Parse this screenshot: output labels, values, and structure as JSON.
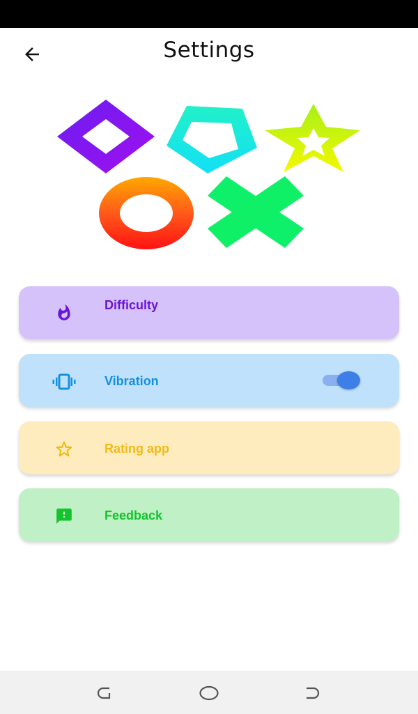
{
  "header": {
    "title": "Settings",
    "back_icon": "arrow-left-icon"
  },
  "logo": {
    "shapes": [
      "diamond",
      "pentagon",
      "star",
      "ring",
      "cross"
    ]
  },
  "settings": {
    "items": [
      {
        "key": "difficulty",
        "label": "Difficulty",
        "icon": "flame-icon",
        "bg": "#d6c2fb",
        "color": "#6a16d6"
      },
      {
        "key": "vibration",
        "label": "Vibration",
        "icon": "vibration-icon",
        "bg": "#bfe1fb",
        "color": "#1390e0",
        "toggle_on": true
      },
      {
        "key": "rating",
        "label": "Rating app",
        "icon": "star-outline-icon",
        "bg": "#feecbf",
        "color": "#f2ba15"
      },
      {
        "key": "feedback",
        "label": "Feedback",
        "icon": "feedback-icon",
        "bg": "#c0f0c5",
        "color": "#14c42c"
      }
    ]
  },
  "toggle": {
    "track": "#8ab0f2",
    "thumb": "#3d7fe7"
  },
  "navigation": {
    "buttons": [
      "recents-icon",
      "home-icon",
      "back-nav-icon"
    ]
  }
}
